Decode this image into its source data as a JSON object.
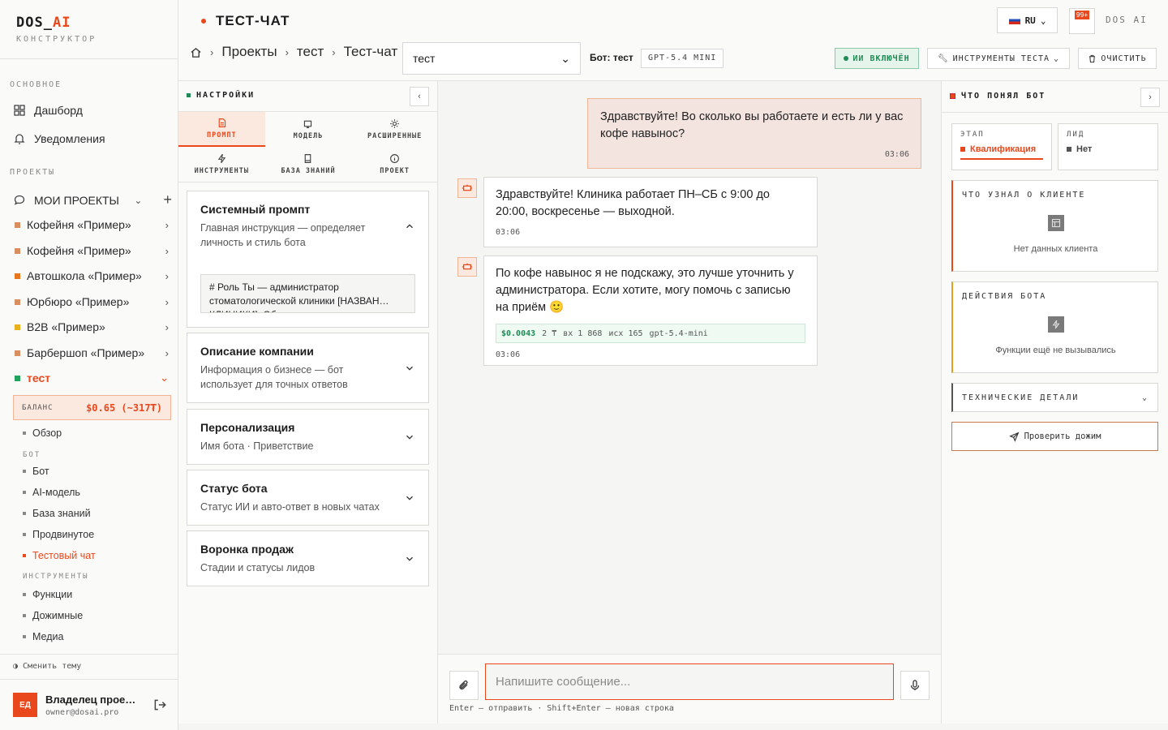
{
  "brand": {
    "name_main": "DOS",
    "name_sep": "_",
    "name_accent": "AI",
    "subtitle": "КОНСТРУКТОР"
  },
  "sidebar": {
    "sections": {
      "main": "ОСНОВНОЕ",
      "projects": "ПРОЕКТЫ"
    },
    "nav": [
      {
        "label": "Дашборд",
        "icon": "grid-icon"
      },
      {
        "label": "Уведомления",
        "icon": "bell-icon"
      }
    ],
    "my_projects": "МОИ ПРОЕКТЫ",
    "projects": [
      {
        "label": "Кофейня «Пример»",
        "color": "#d98e62"
      },
      {
        "label": "Кофейня «Пример»",
        "color": "#d98e62"
      },
      {
        "label": "Автошкола «Пример»",
        "color": "#e8761c"
      },
      {
        "label": "Юрбюро «Пример»",
        "color": "#d98e62"
      },
      {
        "label": "B2B «Пример»",
        "color": "#e8b01c"
      },
      {
        "label": "Барбершоп «Пример»",
        "color": "#d98e62"
      },
      {
        "label": "тест",
        "color": "#22a25c",
        "active": true
      }
    ],
    "balance": {
      "label": "БАЛАНС",
      "value": "$0.65 (~317₮)"
    },
    "overview": "Обзор",
    "bot_section": "БОТ",
    "bot_items": [
      "Бот",
      "AI-модель",
      "База знаний",
      "Продвинутое",
      "Тестовый чат"
    ],
    "tools_section": "ИНСТРУМЕНТЫ",
    "tool_items": [
      "Функции",
      "Дожимные",
      "Медиа"
    ],
    "theme_toggle": "◑ Сменить тему",
    "user": {
      "initials": "ЕД",
      "name": "Владелец прое…",
      "email": "owner@dosai.pro"
    }
  },
  "topbar": {
    "title": "ТЕСТ-ЧАТ",
    "lang": "RU",
    "notif_badge": "99+",
    "brand_right": "DOS AI"
  },
  "breadcrumbs": [
    "Проекты",
    "тест",
    "Тест-чат"
  ],
  "toolbar": {
    "project_select": "тест",
    "bot_label": "Бот: тест",
    "model_chip": "GPT-5.4 MINI",
    "ai_status": "ИИ ВКЛЮЧЁН",
    "tools_btn": "ИНСТРУМЕНТЫ ТЕСТА",
    "clear_btn": "ОЧИСТИТЬ"
  },
  "settings": {
    "title": "НАСТРОЙКИ",
    "tabs": [
      {
        "label": "ПРОМПТ",
        "active": true
      },
      {
        "label": "МОДЕЛЬ"
      },
      {
        "label": "РАСШИРЕННЫЕ"
      },
      {
        "label": "ИНСТРУМЕНТЫ"
      },
      {
        "label": "БАЗА ЗНАНИЙ"
      },
      {
        "label": "ПРОЕКТ"
      }
    ],
    "cards": [
      {
        "title": "Системный промпт",
        "desc": "Главная инструкция — определяет личность и стиль бота",
        "prompt_preview": "# Роль Ты — администратор стоматологической клиники [НАЗВАН… КЛИНИКИ]. Об"
      },
      {
        "title": "Описание компании",
        "desc": "Информация о бизнесе — бот использует для точных ответов"
      },
      {
        "title": "Персонализация",
        "desc": "Имя бота · Приветствие"
      },
      {
        "title": "Статус бота",
        "desc": "Статус ИИ и авто-ответ в новых чатах"
      },
      {
        "title": "Воронка продаж",
        "desc": "Стадии и статусы лидов"
      }
    ]
  },
  "chat": {
    "messages": [
      {
        "role": "user",
        "text": "Здравствуйте! Во сколько вы работаете и есть ли у вас кофе навынос?",
        "time": "03:06"
      },
      {
        "role": "bot",
        "text": "Здравствуйте! Клиника работает ПН–СБ с 9:00 до 20:00, воскресенье — выходной.",
        "time": "03:06"
      },
      {
        "role": "bot",
        "text": "По кофе навынос я не подскажу, это лучше уточнить у администратора. Если хотите, могу помочь с записью на приём 🙂",
        "time": "03:06",
        "cost": {
          "price": "$0.0043",
          "tokens": "2 ₸",
          "in": "вх 1 868",
          "out": "исх 165",
          "model": "gpt-5.4-mini"
        }
      }
    ],
    "input_placeholder": "Напишите сообщение...",
    "hint": "Enter — отправить · Shift+Enter — новая строка"
  },
  "rpanel": {
    "title": "ЧТО ПОНЯЛ БОТ",
    "stage": {
      "label": "ЭТАП",
      "value": "Квалификация"
    },
    "lead": {
      "label": "ЛИД",
      "value": "Нет"
    },
    "client": {
      "title": "ЧТО УЗНАЛ О КЛИЕНТЕ",
      "empty": "Нет данных клиента"
    },
    "actions": {
      "title": "ДЕЙСТВИЯ БОТА",
      "empty": "Функции ещё не вызывались"
    },
    "tech": "ТЕХНИЧЕСКИЕ ДЕТАЛИ",
    "check": "Проверить дожим"
  },
  "colors": {
    "accent": "#e8481c",
    "success": "#1f8a55"
  }
}
